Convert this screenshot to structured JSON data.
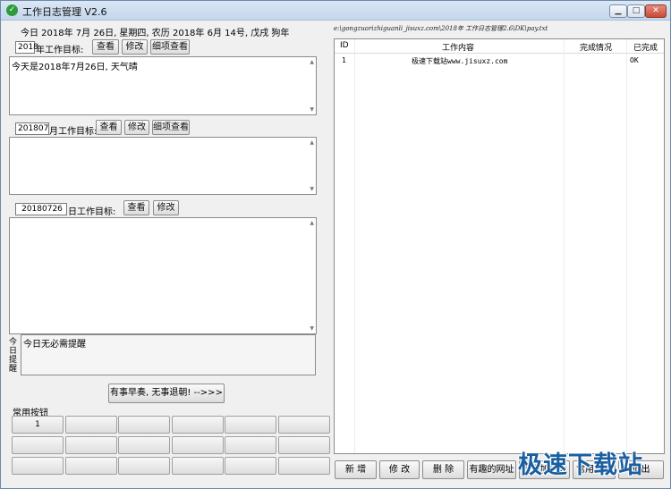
{
  "window": {
    "title": "工作日志管理 V2.6",
    "icon": "check-circle-icon",
    "controls": [
      "minimize-icon",
      "maximize-icon",
      "close-icon"
    ]
  },
  "date_line": "今日 2018年 7月 26日, 星期四, 农历 2018年 6月 14号, 戊戌 狗年",
  "file_path": "e:\\gongzuorizhiguanli_jisuxz.com\\2018年 工作日志管理2.6\\DK\\pay.txt",
  "year_goal": {
    "year_value": "2018",
    "label": "年工作目标:",
    "view_btn": "查看",
    "edit_btn": "修改",
    "detail_btn": "细项查看",
    "content": "今天是2018年7月26日, 天气晴"
  },
  "month_goal": {
    "month_value": "201807",
    "label": "月工作目标:",
    "view_btn": "查看",
    "edit_btn": "修改",
    "detail_btn": "细项查看",
    "content": ""
  },
  "day_goal": {
    "day_value": "20180726",
    "label": "日工作目标:",
    "view_btn": "查看",
    "edit_btn": "修改",
    "content": ""
  },
  "reminder": {
    "label": "今日提醒",
    "content": "今日无必需提醒"
  },
  "motto_button": "有事早奏, 无事退朝! -->>>",
  "common_buttons": {
    "label": "常用按钮",
    "items": [
      "1",
      "",
      "",
      "",
      "",
      "",
      "",
      "",
      "",
      "",
      "",
      "",
      "",
      "",
      "",
      "",
      "",
      ""
    ]
  },
  "table": {
    "headers": [
      "ID",
      "工作内容",
      "完成情况",
      "已完成"
    ],
    "rows": [
      {
        "id": "1",
        "content": "极速下载站www.jisuxz.com",
        "status": "",
        "done": "OK"
      }
    ]
  },
  "bottom_buttons": [
    "新 增",
    "修 改",
    "删 除",
    "有趣的网址",
    "待添加功能",
    "常用按钮",
    "退出"
  ],
  "watermark": "极速下载站"
}
